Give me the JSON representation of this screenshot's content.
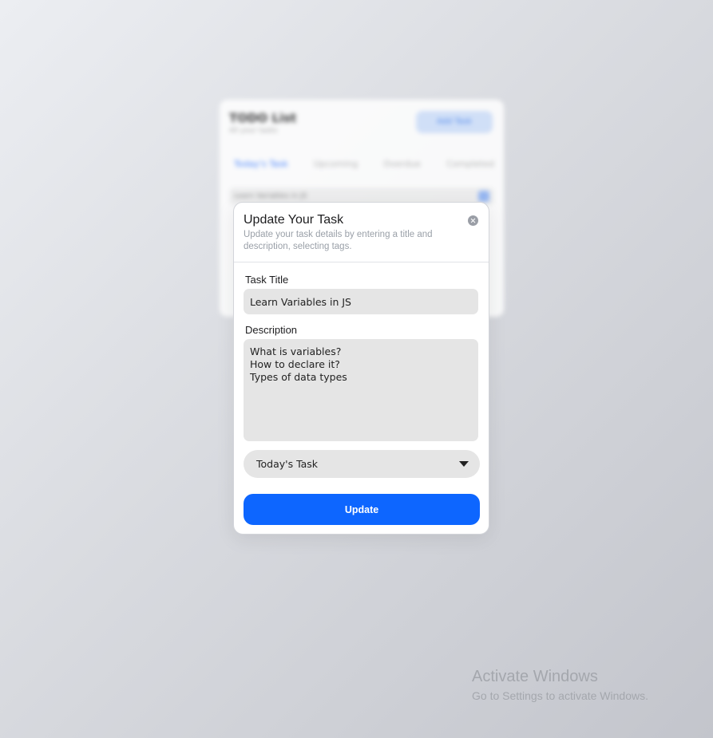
{
  "background_app": {
    "title": "TODO List",
    "subtitle": "All your tasks",
    "add_button": "Add Task",
    "tabs": [
      "Today's Task",
      "Upcoming",
      "Overdue",
      "Completed"
    ],
    "first_row": "Learn Variables in JS"
  },
  "modal": {
    "title": "Update Your Task",
    "description": "Update your task details by entering a title and description, selecting tags.",
    "task_title_label": "Task Title",
    "task_title_value": "Learn Variables in JS",
    "description_label": "Description",
    "description_value": "What is variables?\nHow to declare it?\nTypes of data types",
    "tag_selected": "Today's Task",
    "update_button": "Update"
  },
  "watermark": {
    "title": "Activate Windows",
    "subtitle": "Go to Settings to activate Windows."
  },
  "colors": {
    "accent": "#0d66ff",
    "field_bg": "#e5e5e5"
  },
  "icons": {
    "close": "close-icon",
    "dropdown": "chevron-down-icon"
  }
}
